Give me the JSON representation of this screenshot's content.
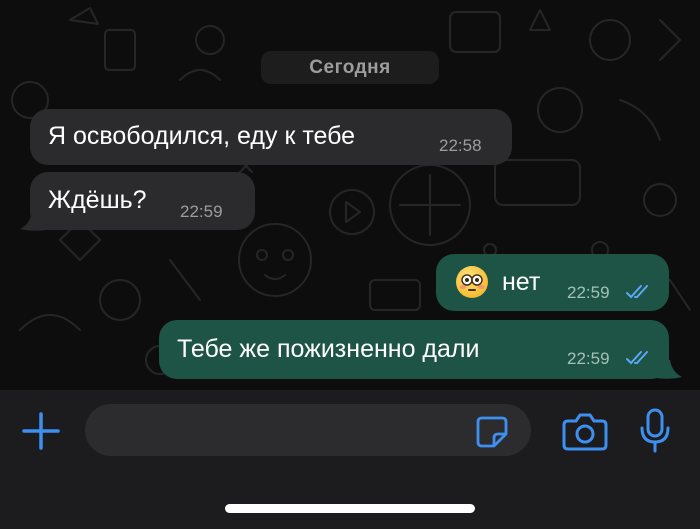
{
  "date_separator": "Сегодня",
  "messages": [
    {
      "direction": "in",
      "text": "Я освободился, еду к тебе",
      "time": "22:58"
    },
    {
      "direction": "in",
      "text": "Ждёшь?",
      "time": "22:59"
    },
    {
      "direction": "out",
      "emoji": "flushed-face",
      "text": "нет",
      "time": "22:59",
      "status": "read"
    },
    {
      "direction": "out",
      "text": "Тебе же пожизненно дали",
      "time": "22:59",
      "status": "read"
    }
  ],
  "composer": {
    "placeholder": "",
    "icons": [
      "plus-icon",
      "sticker-icon",
      "camera-icon",
      "microphone-icon"
    ]
  },
  "colors": {
    "accent": "#3d8ff0",
    "incoming_bubble": "#2b2b2d",
    "outgoing_bubble": "#1e5445",
    "read_ticks": "#5aa8f5"
  }
}
